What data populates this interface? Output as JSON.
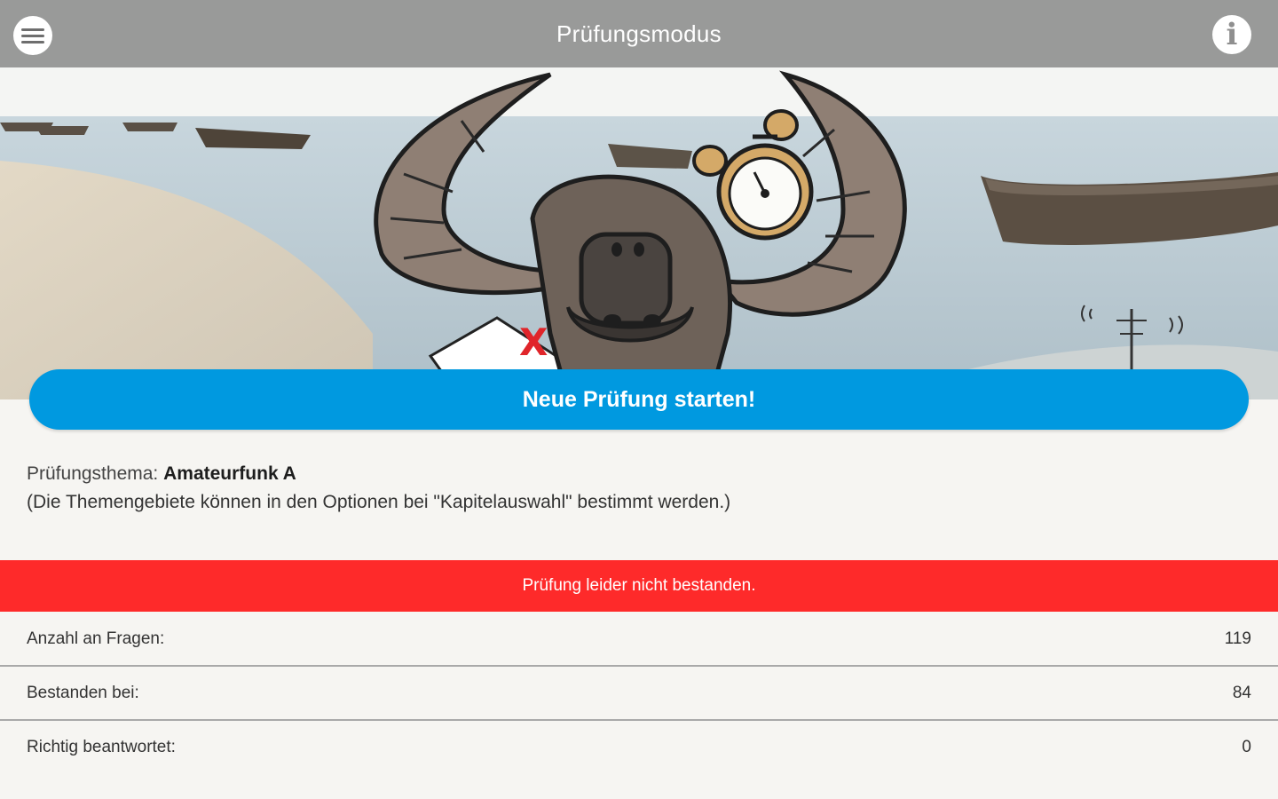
{
  "header": {
    "title": "Prüfungsmodus",
    "menu_icon": "menu-icon",
    "info_icon": "info-icon",
    "info_glyph": "i"
  },
  "hero": {
    "description_icon": "wildebeest-mascot-with-alarm-clock",
    "marker": "X"
  },
  "start_button": {
    "label": "Neue Prüfung starten!",
    "color": "#0099e0"
  },
  "topic": {
    "label": "Prüfungsthema:",
    "value": "Amateurfunk A",
    "note": "(Die Themengebiete können in den Optionen bei \"Kapitelauswahl\" bestimmt werden.)"
  },
  "status": {
    "text": "Prüfung leider nicht bestanden.",
    "color": "#fe2a2a"
  },
  "stats": [
    {
      "label": "Anzahl an Fragen:",
      "value": "119"
    },
    {
      "label": "Bestanden bei:",
      "value": "84"
    },
    {
      "label": "Richtig beantwortet:",
      "value": "0"
    }
  ]
}
